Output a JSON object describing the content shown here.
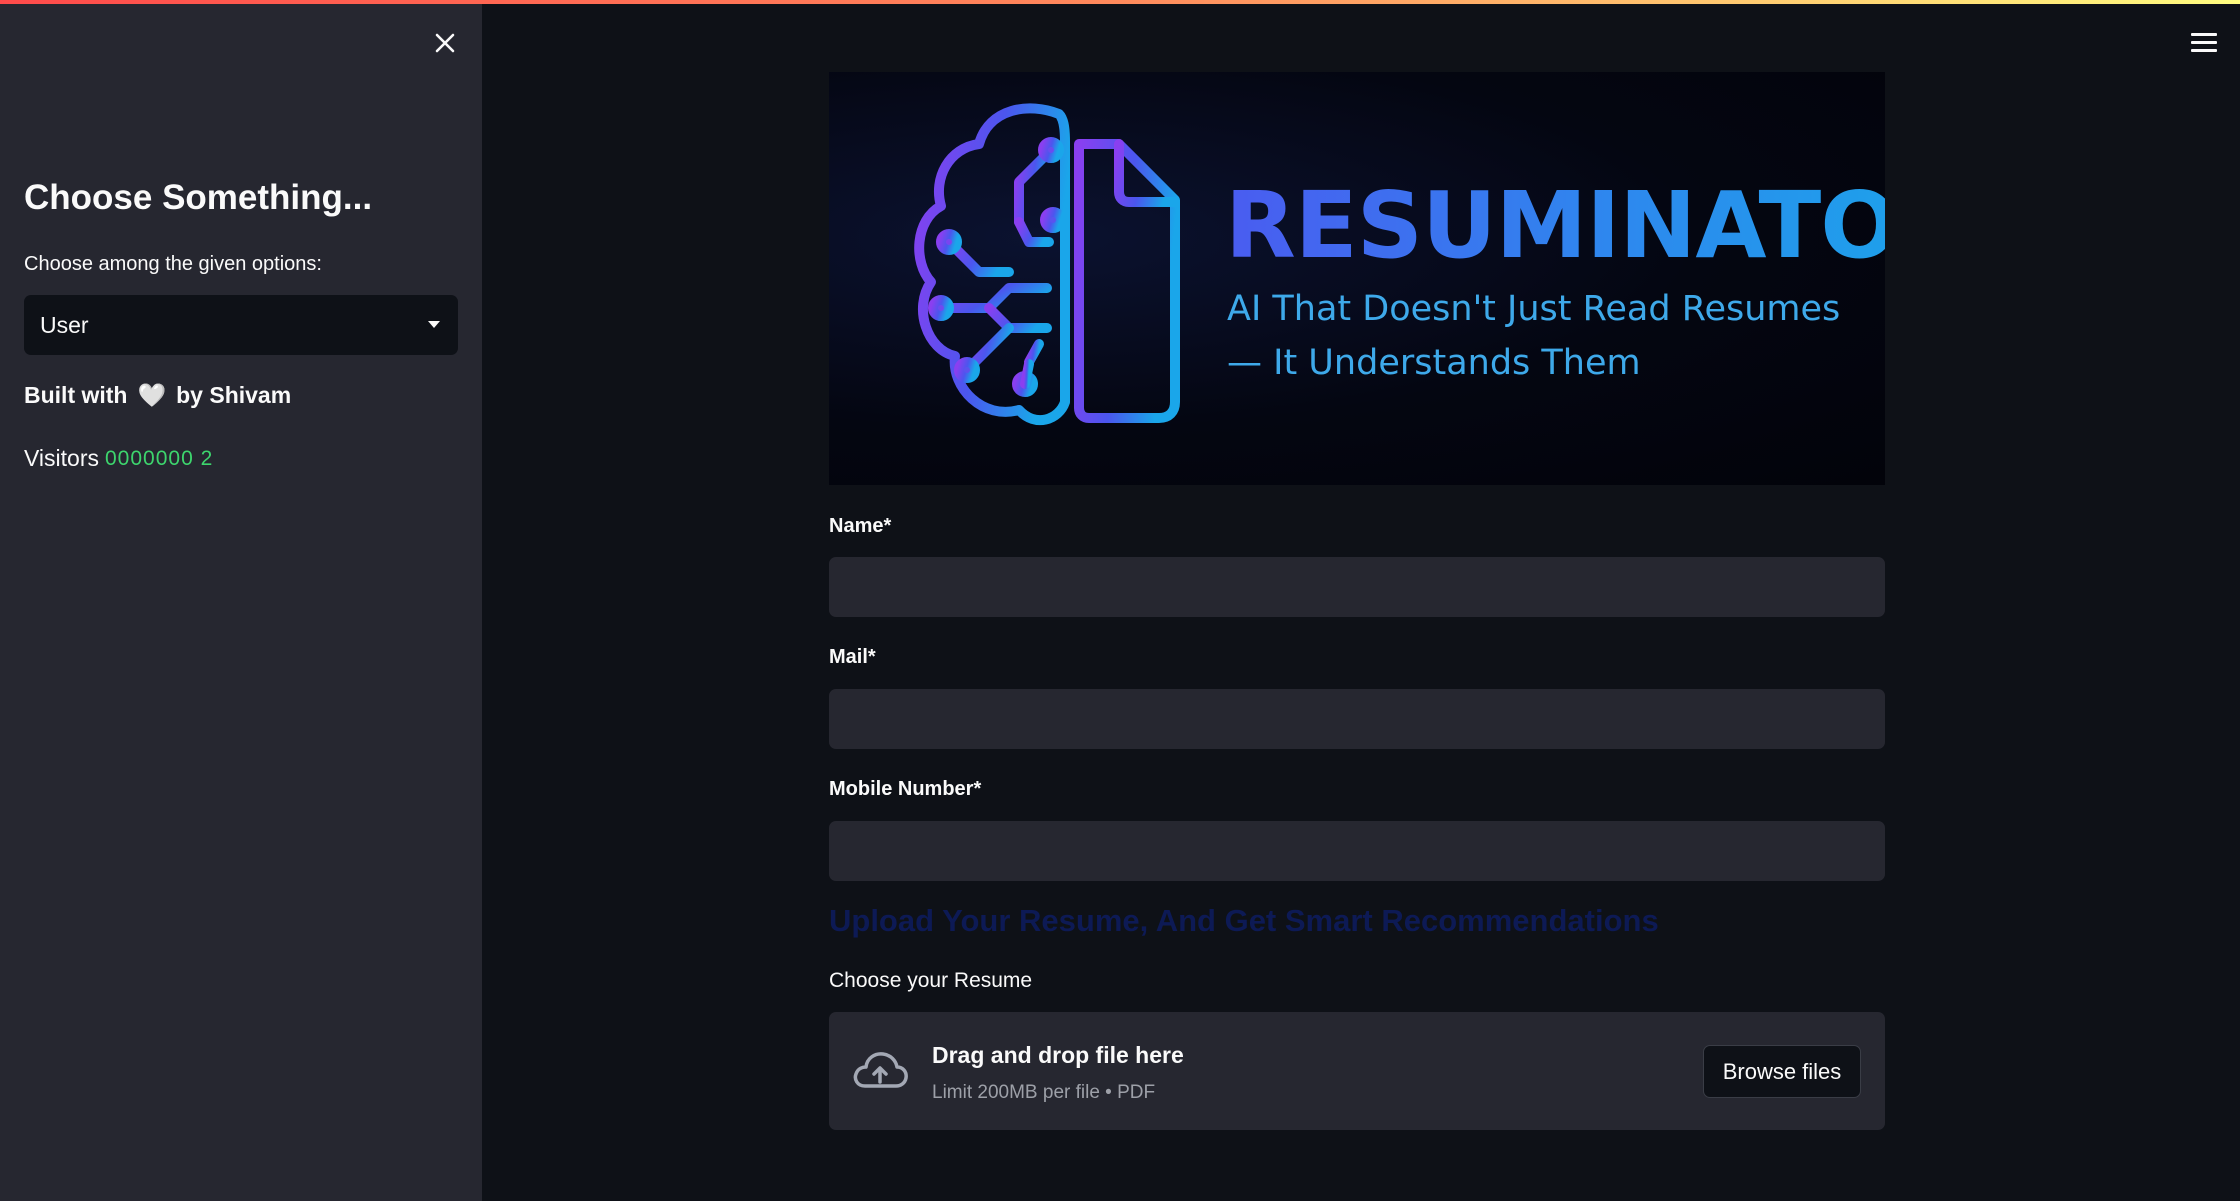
{
  "sidebar": {
    "close_icon": "close-icon",
    "title": "Choose Something...",
    "select_label": "Choose among the given options:",
    "select_value": "User",
    "built_prefix": "Built with",
    "built_heart": "🤍",
    "built_suffix": "by Shivam",
    "visitors_label": "Visitors",
    "visitors_count": "0000000 2"
  },
  "header": {
    "menu_icon": "hamburger-menu-icon"
  },
  "banner": {
    "brand": "RESUMINATOR",
    "tagline": "AI That Doesn't Just Read Resumes — It Understands Them"
  },
  "form": {
    "name_label": "Name*",
    "name_value": "",
    "mail_label": "Mail*",
    "mail_value": "",
    "mobile_label": "Mobile Number*",
    "mobile_value": "",
    "upload_heading": "Upload Your Resume, And Get Smart Recommendations",
    "resume_label": "Choose your Resume",
    "drop_title": "Drag and drop file here",
    "drop_limit": "Limit 200MB per file • PDF",
    "browse_label": "Browse files"
  },
  "colors": {
    "background": "#0e1117",
    "sidebar": "#262730",
    "input": "#262730",
    "brand_gradient_start": "#4a5cf0",
    "brand_gradient_end": "#1aa6ea",
    "visitor_count": "#3dd56d"
  }
}
